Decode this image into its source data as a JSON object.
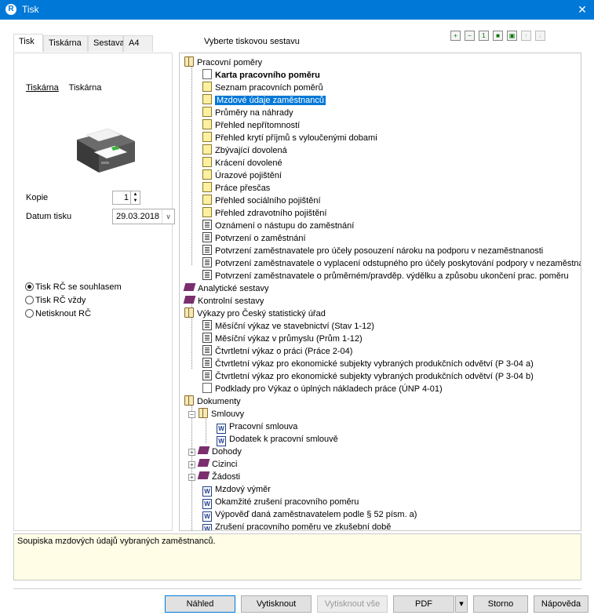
{
  "window": {
    "title": "Tisk",
    "close_glyph": "✕"
  },
  "tabs": [
    "Tisk",
    "Tiskárna",
    "Sestava",
    "A4"
  ],
  "left": {
    "printer_link": "Tiskárna",
    "printer_name": "Tiskárna",
    "copies_label": "Kopie",
    "copies_value": "1",
    "date_label": "Datum tisku",
    "date_value": "29.03.2018",
    "radios": [
      "Tisk RČ se souhlasem",
      "Tisk RČ vždy",
      "Netisknout RČ"
    ],
    "radio_selected": 0
  },
  "header_label": "Vyberte tiskovou sestavu",
  "toolbar_icons": [
    "expand-all-icon",
    "collapse-all-icon",
    "item-icon-1",
    "item-icon-2",
    "item-icon-3",
    "move-up-icon",
    "move-down-icon"
  ],
  "tree": {
    "pracovni_pomery": "Pracovní poměry",
    "items_pp": [
      "Karta pracovního poměru",
      "Seznam pracovních poměrů",
      "Mzdové údaje zaměstnanců",
      "Průměry na náhrady",
      "Přehled nepřítomností",
      "Přehled krytí příjmů s vyloučenými dobami",
      "Zbývající dovolená",
      "Krácení dovolené",
      "Úrazové pojištění",
      "Práce přesčas",
      "Přehled sociálního pojištění",
      "Přehled zdravotního pojištění",
      "Oznámení o nástupu do zaměstnání",
      "Potvrzení o zaměstnání",
      "Potvrzení zaměstnavatele pro účely posouzení nároku na podporu v nezaměstnanosti",
      "Potvrzení zaměstnavatele o vyplacení odstupného pro účely poskytování podpory v nezaměstnanosti",
      "Potvrzení zaměstnavatele o průměrném/pravděp. výdělku a způsobu ukončení prac. poměru"
    ],
    "analyticke": "Analytické sestavy",
    "kontrolni": "Kontrolní sestavy",
    "csu": "Výkazy pro Český statistický úřad",
    "items_csu": [
      "Měsíční výkaz ve stavebnictví (Stav 1-12)",
      "Měsíční výkaz v průmyslu (Prům 1-12)",
      "Čtvrtletní výkaz o práci (Práce 2-04)",
      "Čtvrtletní výkaz pro ekonomické subjekty vybraných produkčních odvětví (P 3-04 a)",
      "Čtvrtletní výkaz pro ekonomické subjekty vybraných produkčních odvětví (P 3-04 b)",
      "Podklady pro Výkaz o úplných nákladech práce (ÚNP 4-01)"
    ],
    "dokumenty": "Dokumenty",
    "smlouvy": "Smlouvy",
    "items_smlouvy": [
      "Pracovní smlouva",
      "Dodatek k pracovní smlouvě"
    ],
    "dohody": "Dohody",
    "cizinci": "Cizinci",
    "zadosti": "Žádosti",
    "items_dok": [
      "Mzdový výměr",
      "Okamžité zrušení pracovního poměru",
      "Výpověď daná zaměstnavatelem podle § 52 písm. a)",
      "Zrušení pracovního poměru ve zkušební době"
    ],
    "word_glyph": "W",
    "plus_glyph": "+",
    "minus_glyph": "−"
  },
  "description": "Soupiska mzdových údajů vybraných zaměstnanců.",
  "buttons": {
    "preview": "Náhled",
    "print": "Vytisknout",
    "print_all": "Vytisknout vše",
    "pdf": "PDF",
    "pdf_arrow": "▾",
    "cancel": "Storno",
    "help": "Nápověda"
  }
}
